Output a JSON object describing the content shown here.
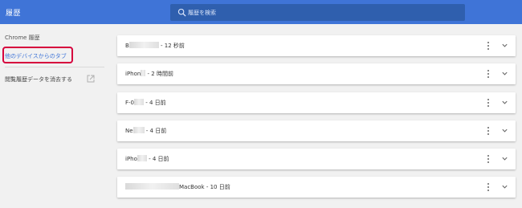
{
  "header": {
    "title": "履歴",
    "search_placeholder": "履歴を検索"
  },
  "sidebar": {
    "heading": "Chrome 履歴",
    "other_devices_tab": "他のデバイスからのタブ",
    "clear_browsing_data": "閲覧履歴データを消去する"
  },
  "devices": [
    {
      "name": "B",
      "time": " - 12 秒前"
    },
    {
      "name": "iPhon",
      "time": " - 2 時間前"
    },
    {
      "name": "F-0",
      "time": " - 4 日前"
    },
    {
      "name": "Ne",
      "time": " - 4 日前"
    },
    {
      "name": "iPho",
      "time": " - 4 日前"
    },
    {
      "name": "MacBook",
      "time": " - 10 日前"
    }
  ],
  "colors": {
    "topbar": "#3f74d7",
    "search": "#2f5fae",
    "link": "#3f74d7",
    "highlight": "#d6003d"
  }
}
